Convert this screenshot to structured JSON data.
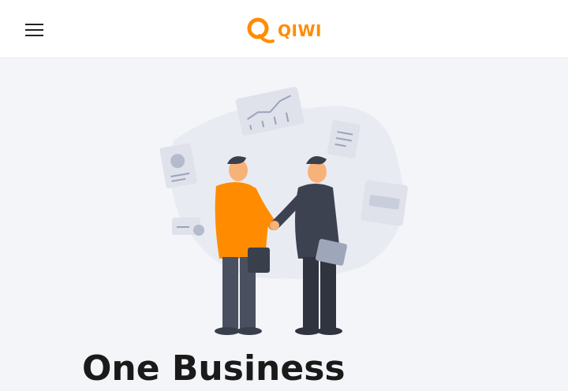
{
  "header": {
    "logo_text": "QIWI",
    "menu_icon": "hamburger-menu-icon",
    "brand_color": "#ff8c00"
  },
  "hero": {
    "illustration": "business-handshake-illustration",
    "headline": "One Business"
  }
}
